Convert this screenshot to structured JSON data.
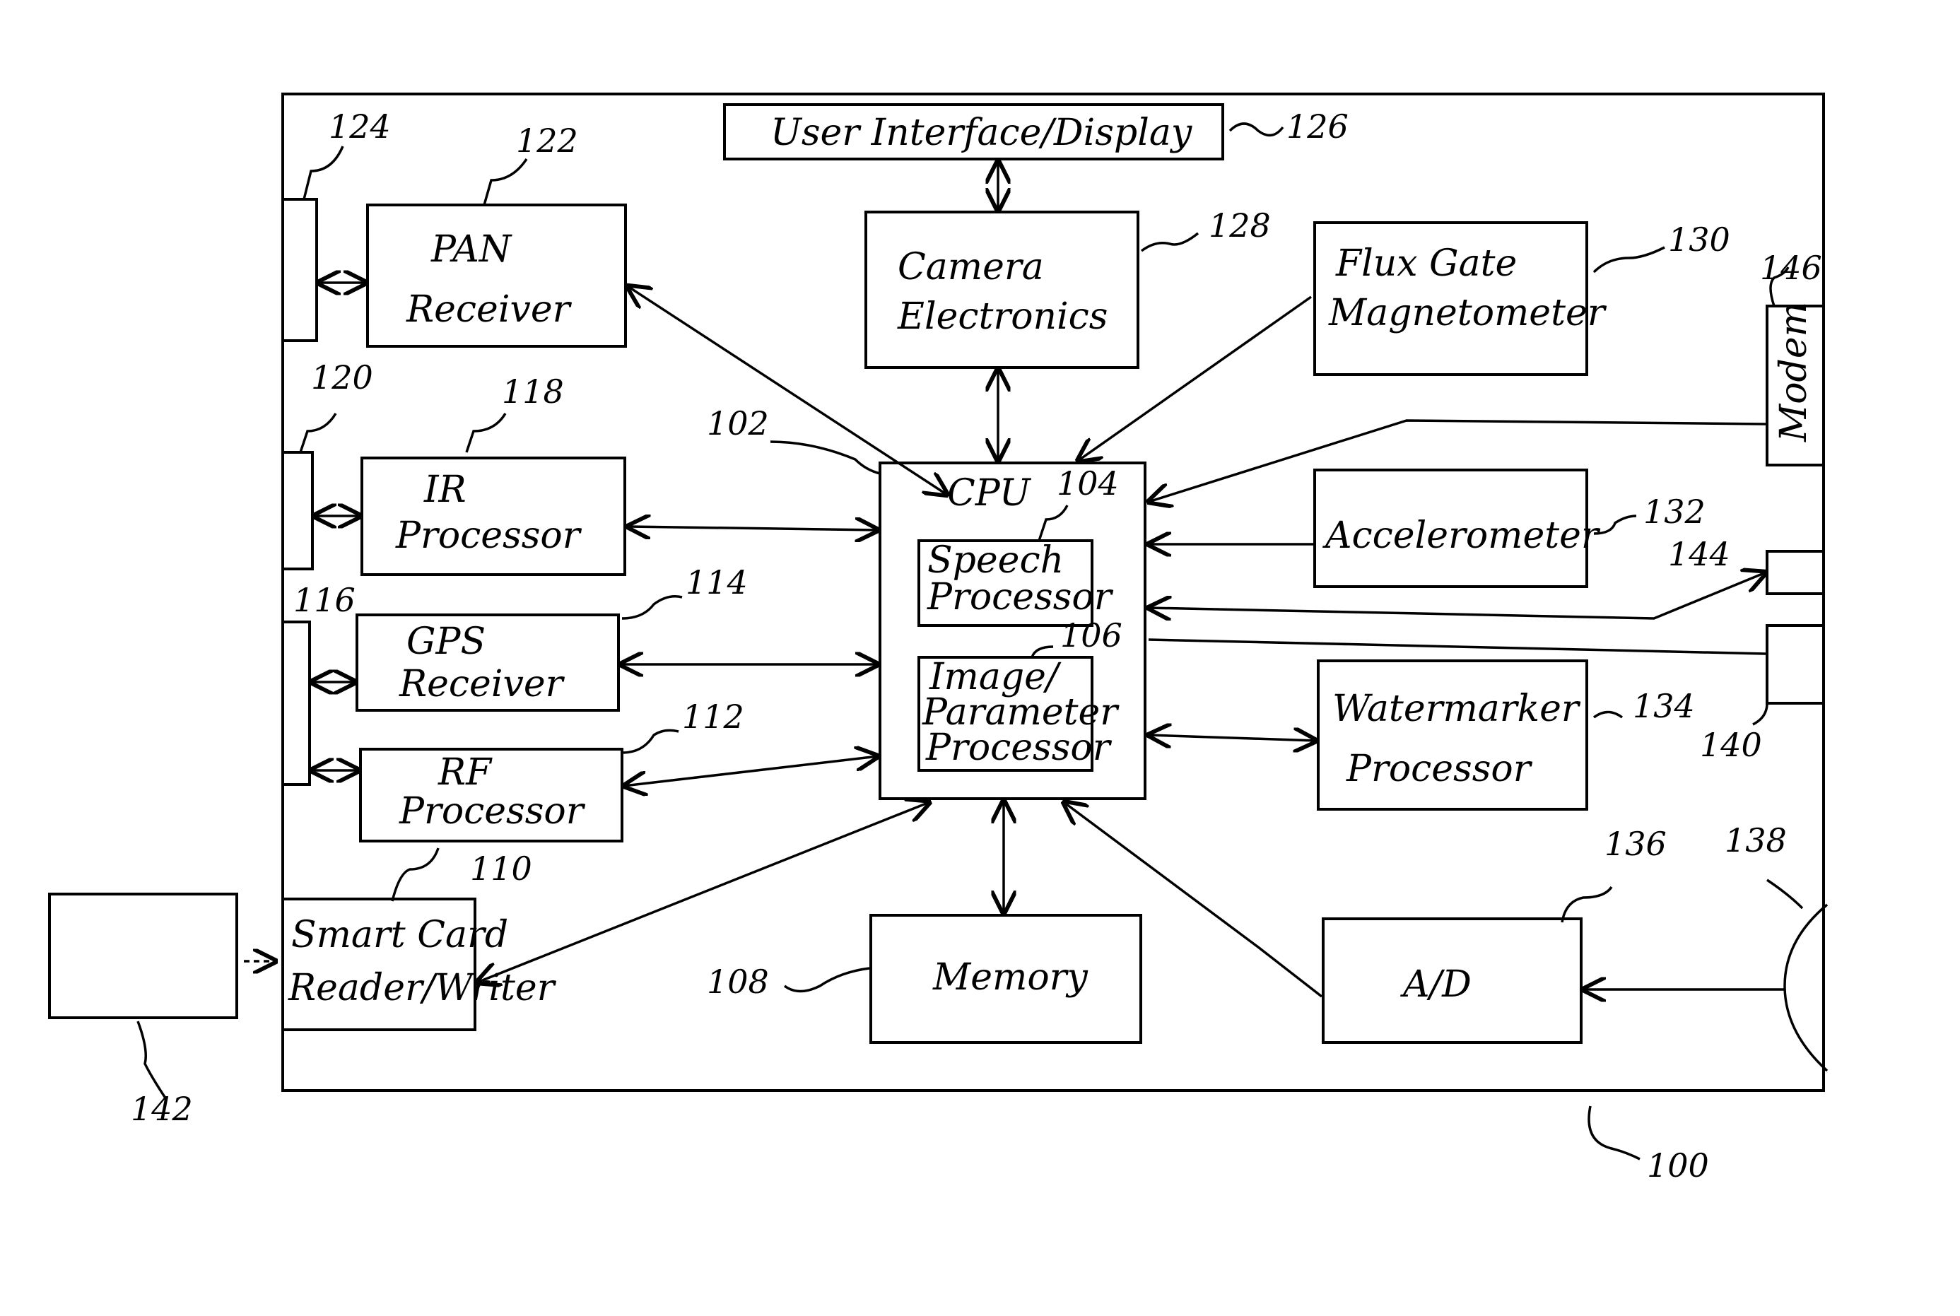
{
  "figure": {
    "device_ref": "100",
    "blocks": {
      "ui_display": {
        "label": "User Interface/Display",
        "ref": "126"
      },
      "camera": {
        "label1": "Camera",
        "label2": "Electronics",
        "ref": "128"
      },
      "flux": {
        "label1": "Flux Gate",
        "label2": "Magnetometer",
        "ref": "130"
      },
      "pan": {
        "label1": "PAN",
        "label2": "Receiver",
        "ref": "122"
      },
      "pan_port": {
        "ref": "124"
      },
      "ir": {
        "label1": "IR",
        "label2": "Processor",
        "ref": "118"
      },
      "ir_port": {
        "ref": "120"
      },
      "gps": {
        "label1": "GPS",
        "label2": "Receiver",
        "ref": "114"
      },
      "rf": {
        "label1": "RF",
        "label2": "Processor",
        "ref": "112"
      },
      "gps_rf_port": {
        "ref": "116"
      },
      "cpu": {
        "label": "CPU",
        "ref": "104",
        "bus_ref": "102"
      },
      "speech": {
        "label1": "Speech",
        "label2": "Processor"
      },
      "image": {
        "label1": "Image/",
        "label2": "Parameter",
        "label3": "Processor",
        "ref": "106"
      },
      "modem": {
        "label": "Modem",
        "ref": "146"
      },
      "accel": {
        "label": "Accelerometer",
        "ref": "132"
      },
      "port144": {
        "ref": "144"
      },
      "port140": {
        "ref": "140"
      },
      "watermarker": {
        "label1": "Watermarker",
        "label2": "Processor",
        "ref": "134"
      },
      "smartcard": {
        "label1": "Smart Card",
        "label2": "Reader/Writer",
        "ref": "110"
      },
      "card": {
        "ref": "142"
      },
      "memory": {
        "label": "Memory",
        "ref": "108"
      },
      "ad": {
        "label": "A/D",
        "ref": "136"
      },
      "mic": {
        "ref": "138"
      }
    }
  }
}
